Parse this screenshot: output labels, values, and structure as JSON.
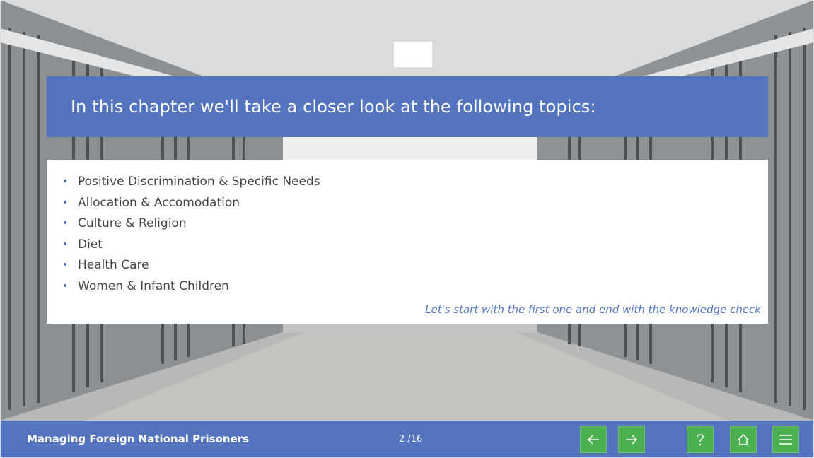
{
  "slide": {
    "heading": "In this chapter we'll take a closer look at the following topics:",
    "topics": [
      "Positive Discrimination & Specific Needs",
      "Allocation & Accomodation",
      "Culture & Religion",
      "Diet",
      "Health Care",
      "Women & Infant Children"
    ],
    "note": "Let's start with the first one and end with the knowledge check"
  },
  "footer": {
    "course_title": "Managing Foreign National Prisoners",
    "page_counter": "2 /16",
    "buttons": {
      "back_icon": "arrow-left-icon",
      "next_icon": "arrow-right-icon",
      "help_icon": "question-mark-icon",
      "home_icon": "home-icon",
      "menu_icon": "hamburger-menu-icon"
    }
  },
  "colors": {
    "accent": "#5474c0",
    "button": "#4caf50",
    "text": "#444444"
  }
}
